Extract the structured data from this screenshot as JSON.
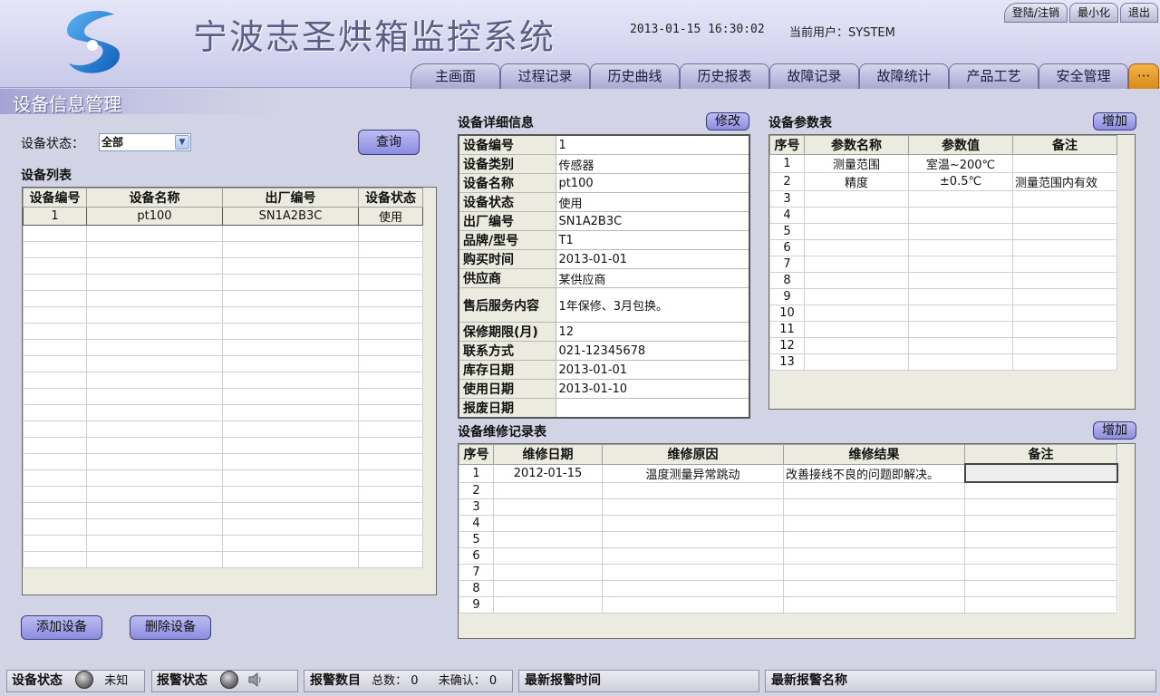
{
  "header": {
    "title": "宁波志圣烘箱监控系统",
    "datetime": "2013-01-15 16:30:02",
    "current_user": "当前用户：SYSTEM",
    "system_buttons": [
      "登陆/注销",
      "最小化",
      "退出"
    ],
    "nav_tabs": [
      "主画面",
      "过程记录",
      "历史曲线",
      "历史报表",
      "故障记录",
      "故障统计",
      "产品工艺",
      "安全管理"
    ],
    "nav_more": "···"
  },
  "page": {
    "title": "设备信息管理"
  },
  "filter": {
    "status_label": "设备状态：",
    "status_value": "全部",
    "query_button": "查询"
  },
  "device_list": {
    "title": "设备列表",
    "columns": [
      "设备编号",
      "设备名称",
      "出厂编号",
      "设备状态"
    ],
    "rows": [
      [
        "1",
        "pt100",
        "SN1A2B3C",
        "使用"
      ]
    ],
    "add_button": "添加设备",
    "delete_button": "删除设备"
  },
  "detail": {
    "title": "设备详细信息",
    "edit_button": "修改",
    "fields": [
      {
        "k": "设备编号",
        "v": "1"
      },
      {
        "k": "设备类别",
        "v": "传感器"
      },
      {
        "k": "设备名称",
        "v": "pt100"
      },
      {
        "k": "设备状态",
        "v": "使用"
      },
      {
        "k": "出厂编号",
        "v": "SN1A2B3C"
      },
      {
        "k": "品牌/型号",
        "v": "T1"
      },
      {
        "k": "购买时间",
        "v": "2013-01-01"
      },
      {
        "k": "供应商",
        "v": "某供应商"
      },
      {
        "k": "售后服务内容",
        "v": "1年保修、3月包换。"
      },
      {
        "k": "保修期限(月)",
        "v": "12"
      },
      {
        "k": "联系方式",
        "v": "021-12345678"
      },
      {
        "k": "库存日期",
        "v": "2013-01-01"
      },
      {
        "k": "使用日期",
        "v": "2013-01-10"
      },
      {
        "k": "报废日期",
        "v": ""
      }
    ]
  },
  "params": {
    "title": "设备参数表",
    "add_button": "增加",
    "columns": [
      "序号",
      "参数名称",
      "参数值",
      "备注"
    ],
    "rows": [
      [
        "1",
        "测量范围",
        "室温~200℃",
        ""
      ],
      [
        "2",
        "精度",
        "±0.5℃",
        "测量范围内有效"
      ],
      [
        "3",
        "",
        "",
        ""
      ],
      [
        "4",
        "",
        "",
        ""
      ],
      [
        "5",
        "",
        "",
        ""
      ],
      [
        "6",
        "",
        "",
        ""
      ],
      [
        "7",
        "",
        "",
        ""
      ],
      [
        "8",
        "",
        "",
        ""
      ],
      [
        "9",
        "",
        "",
        ""
      ],
      [
        "10",
        "",
        "",
        ""
      ],
      [
        "11",
        "",
        "",
        ""
      ],
      [
        "12",
        "",
        "",
        ""
      ],
      [
        "13",
        "",
        "",
        ""
      ]
    ]
  },
  "repairs": {
    "title": "设备维修记录表",
    "add_button": "增加",
    "columns": [
      "序号",
      "维修日期",
      "维修原因",
      "维修结果",
      "备注"
    ],
    "rows": [
      [
        "1",
        "2012-01-15",
        "温度测量异常跳动",
        "改善接线不良的问题即解决。",
        ""
      ],
      [
        "2",
        "",
        "",
        "",
        ""
      ],
      [
        "3",
        "",
        "",
        "",
        ""
      ],
      [
        "4",
        "",
        "",
        "",
        ""
      ],
      [
        "5",
        "",
        "",
        "",
        ""
      ],
      [
        "6",
        "",
        "",
        "",
        ""
      ],
      [
        "7",
        "",
        "",
        "",
        ""
      ],
      [
        "8",
        "",
        "",
        "",
        ""
      ],
      [
        "9",
        "",
        "",
        "",
        ""
      ]
    ]
  },
  "statusbar": {
    "device_status_label": "设备状态",
    "device_status_value": "未知",
    "alarm_status_label": "报警状态",
    "alarm_count_label": "报警数目",
    "alarm_total": "总数：  0",
    "alarm_unconfirmed": "未确认：  0",
    "latest_alarm_time_label": "最新报警时间",
    "latest_alarm_name_label": "最新报警名称"
  },
  "colors": {
    "background": "#d3d3e6",
    "accent_button": "#a4a4ea",
    "nav_more": "#e89e2c",
    "logo_blue": "#1f7fd6"
  }
}
